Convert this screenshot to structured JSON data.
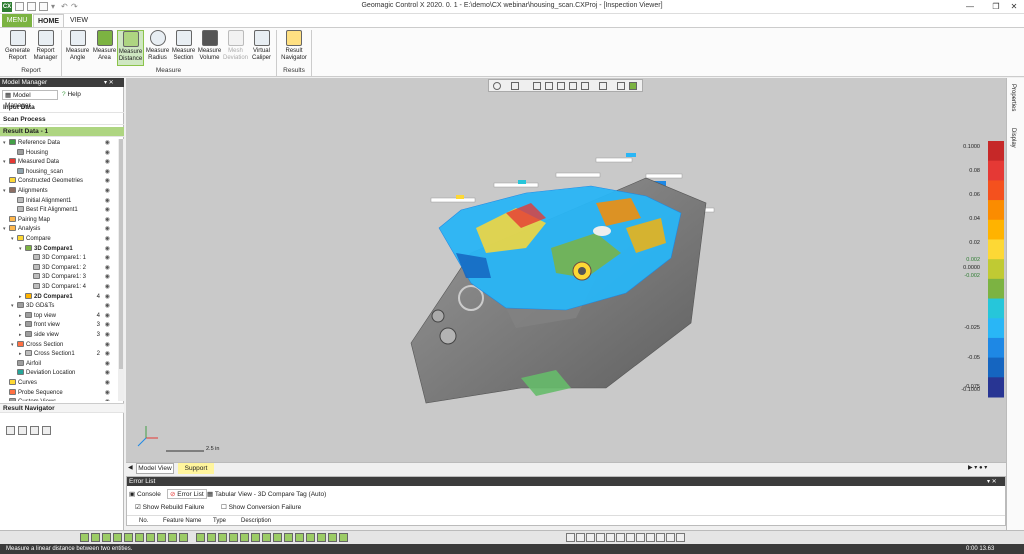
{
  "app": {
    "icon_label": "CX",
    "title": "Geomagic Control X 2020. 0. 1 - E:\\demo\\CX webinar\\housing_scan.CXProj - [Inspection Viewer]"
  },
  "ribbon": {
    "tabs": [
      {
        "label": "MENU"
      },
      {
        "label": "HOME"
      },
      {
        "label": "VIEW"
      }
    ],
    "buttons": [
      {
        "line1": "Generate",
        "line2": "Report",
        "icon": "generate-report-icon"
      },
      {
        "line1": "Report",
        "line2": "Manager",
        "icon": "report-manager-icon"
      },
      {
        "line1": "Measure",
        "line2": "Angle",
        "icon": "measure-angle-icon"
      },
      {
        "line1": "Measure",
        "line2": "Area",
        "icon": "measure-area-icon"
      },
      {
        "line1": "Measure",
        "line2": "Distance",
        "icon": "measure-distance-icon"
      },
      {
        "line1": "Measure",
        "line2": "Radius",
        "icon": "measure-radius-icon"
      },
      {
        "line1": "Measure",
        "line2": "Section",
        "icon": "measure-section-icon"
      },
      {
        "line1": "Measure",
        "line2": "Volume",
        "icon": "measure-volume-icon"
      },
      {
        "line1": "Mesh",
        "line2": "Deviation",
        "icon": "mesh-deviation-icon"
      },
      {
        "line1": "Virtual",
        "line2": "Caliper",
        "icon": "virtual-caliper-icon"
      },
      {
        "line1": "Result",
        "line2": "Navigator",
        "icon": "result-navigator-icon"
      }
    ],
    "groups": [
      {
        "label": "Report"
      },
      {
        "label": "Measure"
      },
      {
        "label": "Results"
      }
    ]
  },
  "model_manager": {
    "title": "Model Manager",
    "tabs": [
      {
        "label": "Model Manager"
      },
      {
        "label": "Help"
      }
    ],
    "input_data": "Input Data",
    "scan_process": "Scan Process",
    "result_data": "Result Data - 1",
    "tree": [
      {
        "label": "Reference Data",
        "count": ""
      },
      {
        "label": "Housing",
        "count": ""
      },
      {
        "label": "Measured Data",
        "count": ""
      },
      {
        "label": "housing_scan",
        "count": ""
      },
      {
        "label": "Constructed Geometries",
        "count": ""
      },
      {
        "label": "Alignments",
        "count": ""
      },
      {
        "label": "Initial Alignment1",
        "count": ""
      },
      {
        "label": "Best Fit Alignment1",
        "count": ""
      },
      {
        "label": "Pairing Map",
        "count": ""
      },
      {
        "label": "Analysis",
        "count": ""
      },
      {
        "label": "Compare",
        "count": ""
      },
      {
        "label": "3D Compare1",
        "count": ""
      },
      {
        "label": "3D Compare1: 1",
        "count": ""
      },
      {
        "label": "3D Compare1: 2",
        "count": ""
      },
      {
        "label": "3D Compare1: 3",
        "count": ""
      },
      {
        "label": "3D Compare1: 4",
        "count": ""
      },
      {
        "label": "2D Compare1",
        "count": "4"
      },
      {
        "label": "3D GD&Ts",
        "count": ""
      },
      {
        "label": "top view",
        "count": "4"
      },
      {
        "label": "front view",
        "count": "3"
      },
      {
        "label": "side view",
        "count": "3"
      },
      {
        "label": "Cross Section",
        "count": ""
      },
      {
        "label": "Cross Section1",
        "count": "2"
      },
      {
        "label": "Airfoil",
        "count": ""
      },
      {
        "label": "Deviation Location",
        "count": ""
      },
      {
        "label": "Curves",
        "count": ""
      },
      {
        "label": "Probe Sequence",
        "count": ""
      },
      {
        "label": "Custom Views",
        "count": ""
      }
    ],
    "result_navigator": "Result Navigator"
  },
  "viewport": {
    "scale_bar_label": "2.5 in",
    "bottom_tabs": [
      {
        "label": "Model View"
      },
      {
        "label": "Support"
      }
    ]
  },
  "color_scale": {
    "labels": [
      "0.1000",
      "0.08",
      "0.06",
      "0.04",
      "0.02",
      "0.002",
      "0.0000",
      "-0.002",
      "-0.025",
      "-0.05",
      "-0.075",
      "-0.1000"
    ],
    "colors": [
      "#c62828",
      "#e53935",
      "#f4511e",
      "#fb8c00",
      "#ffb300",
      "#fdd835",
      "#c0ca33",
      "#7cb342",
      "#26c6da",
      "#29b6f6",
      "#1e88e5",
      "#1565c0",
      "#283593"
    ]
  },
  "right_tabs": [
    {
      "label": "Properties"
    },
    {
      "label": "Display"
    }
  ],
  "error_list": {
    "title": "Error List",
    "tabs": [
      {
        "label": "Console"
      },
      {
        "label": "Error List"
      },
      {
        "label": "Tabular View - 3D Compare Tag (Auto)"
      }
    ],
    "checks": [
      {
        "label": "Show Rebuild Failure"
      },
      {
        "label": "Show Conversion Failure"
      }
    ],
    "columns": [
      {
        "label": "No."
      },
      {
        "label": "Feature Name"
      },
      {
        "label": "Type"
      },
      {
        "label": "Description"
      }
    ]
  },
  "status": {
    "message": "Measure a linear distance between two entities.",
    "time": "0:00 13.63"
  }
}
